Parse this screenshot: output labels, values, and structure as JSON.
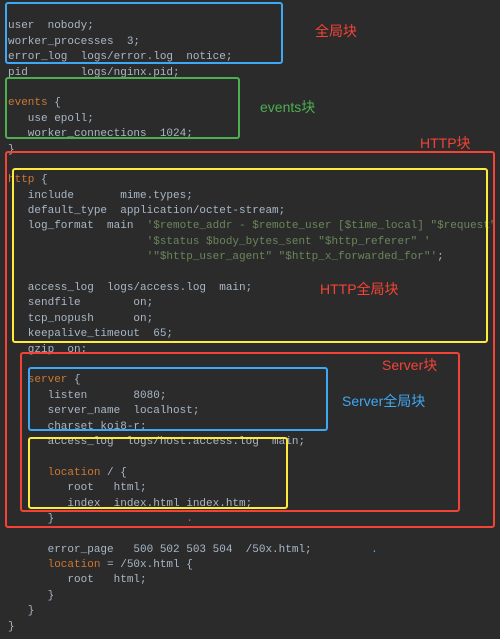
{
  "code": {
    "l1": "user  nobody;",
    "l2": "worker_processes  3;",
    "l3": "error_log  logs/error.log  notice;",
    "l4": "pid        logs/nginx.pid;",
    "l5": "",
    "l6a": "events",
    "l6b": " {",
    "l7": "   use epoll;",
    "l8": "   worker_connections  1024;",
    "l9": "}",
    "l10": "",
    "l11a": "http",
    "l11b": " {",
    "l12": "   include       mime.types;",
    "l13": "   default_type  application/octet-stream;",
    "l14a": "   log_format  main  ",
    "l14b": "'$remote_addr - $remote_user [$time_local] \"$request\" '",
    "l15": "                     '$status $body_bytes_sent \"$http_referer\" '",
    "l16": "                     '\"$http_user_agent\" \"$http_x_forwarded_for\"'",
    "l16b": ";",
    "l17": "",
    "l18": "   access_log  logs/access.log  main;",
    "l19": "   sendfile        on;",
    "l20": "   tcp_nopush      on;",
    "l21": "   keepalive_timeout  65;",
    "l22": "   gzip  on;",
    "l23": "",
    "l24a": "   server",
    "l24b": " {",
    "l25": "      listen       8080;",
    "l26": "      server_name  localhost;",
    "l27": "      charset koi8-r;",
    "l28": "      access_log  logs/host.access.log  main;",
    "l29": "",
    "l30a": "      location",
    "l30b": " / {",
    "l31": "         root   html;",
    "l32": "         index  index.html index.htm;",
    "l33": "      }",
    "l34": "",
    "l35": "      error_page   500 502 503 504  /50x.html;",
    "l36a": "      location",
    "l36b": " = /50x.html {",
    "l37": "         root   html;",
    "l38": "      }",
    "l39": "   }",
    "l40": "}"
  },
  "labels": {
    "global": "全局块",
    "events": "events块",
    "http": "HTTP块",
    "http_global": "HTTP全局块",
    "server": "Server块",
    "server_global": "Server全局块"
  }
}
